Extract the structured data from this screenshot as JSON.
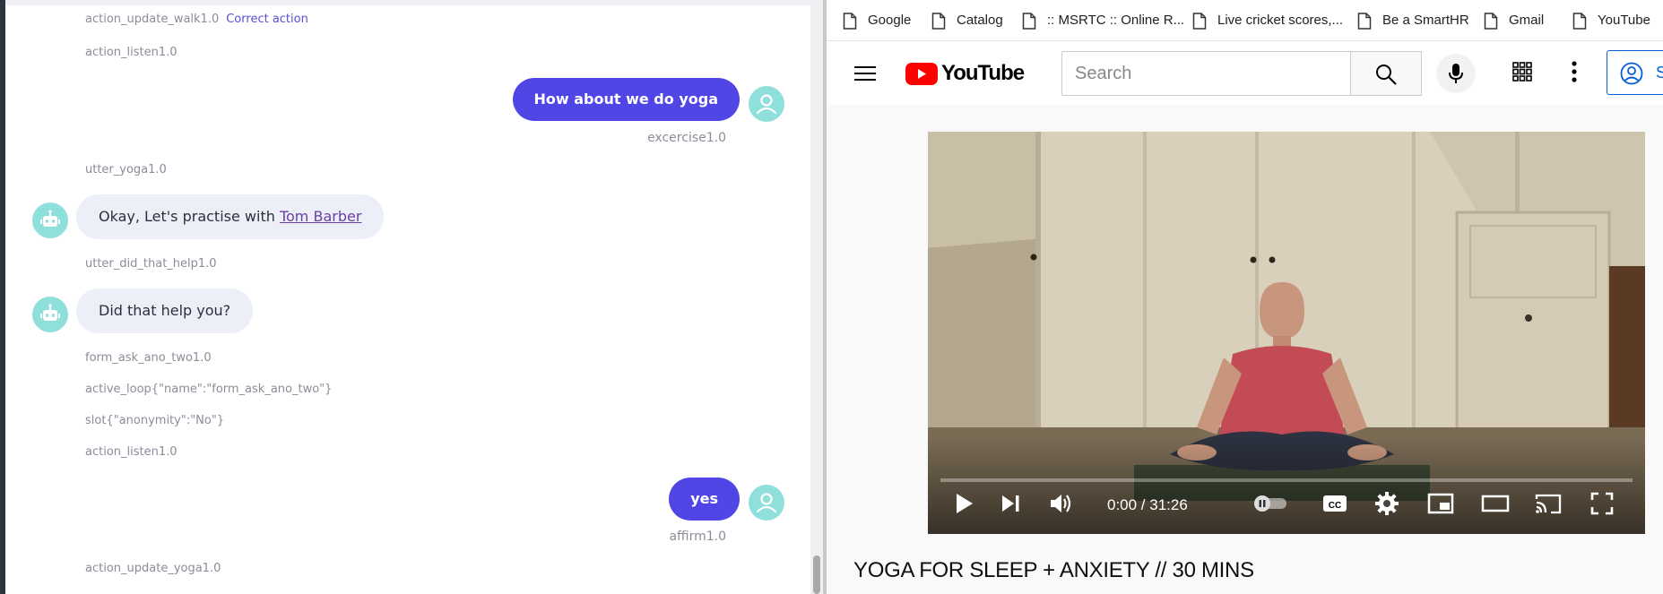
{
  "chat": {
    "messages": [
      {
        "kind": "meta",
        "text": "action_update_walk1.0",
        "extra": "Correct action"
      },
      {
        "kind": "meta",
        "text": "action_listen1.0"
      },
      {
        "kind": "user",
        "text": "How about we do yoga",
        "intent": "excercise1.0"
      },
      {
        "kind": "meta",
        "text": "utter_yoga1.0"
      },
      {
        "kind": "bot",
        "text": "Okay, Let's practise with ",
        "link": "Tom Barber"
      },
      {
        "kind": "meta",
        "text": "utter_did_that_help1.0"
      },
      {
        "kind": "bot",
        "text": "Did that help you?"
      },
      {
        "kind": "meta",
        "text": "form_ask_ano_two1.0"
      },
      {
        "kind": "meta",
        "text": "active_loop{\"name\":\"form_ask_ano_two\"}"
      },
      {
        "kind": "meta",
        "text": "slot{\"anonymity\":\"No\"}"
      },
      {
        "kind": "meta",
        "text": "action_listen1.0"
      },
      {
        "kind": "user",
        "text": "yes",
        "intent": "affirm1.0"
      },
      {
        "kind": "meta",
        "text": "action_update_yoga1.0"
      }
    ]
  },
  "browser": {
    "bookmarks": [
      "Google",
      "Catalog",
      ":: MSRTC :: Online R...",
      "Live cricket scores,...",
      "Be a SmartHR",
      "Gmail",
      "YouTube"
    ],
    "youtube": {
      "logo_text": "YouTube",
      "search_placeholder": "Search",
      "signin_label": "S",
      "player": {
        "time": "0:00 / 31:26",
        "progress": 0.0
      },
      "video_title": "YOGA FOR SLEEP + ANXIETY // 30 MINS"
    }
  },
  "colors": {
    "user_bubble": "#5046e5",
    "bot_bubble": "#eceef8",
    "avatar": "#8fe0db",
    "yt_red": "#ff0000"
  }
}
